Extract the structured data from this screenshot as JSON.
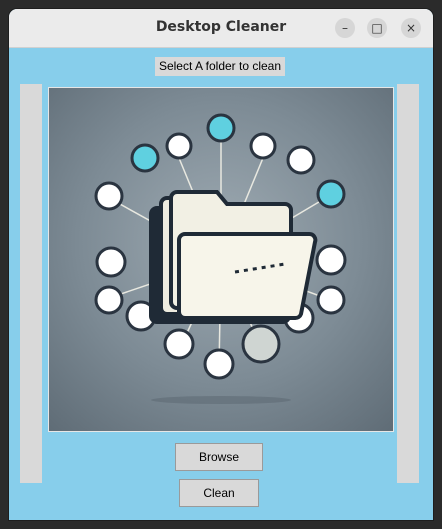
{
  "window": {
    "title": "Desktop Cleaner",
    "controls": {
      "minimize": "–",
      "maximize": "□",
      "close": "×"
    }
  },
  "instruction_label": "Select A folder to clean",
  "image": {
    "icon": "folder-network-illustration"
  },
  "buttons": {
    "browse": "Browse",
    "clean": "Clean"
  },
  "colors": {
    "background": "#87ceeb",
    "widget": "#d9d9d9",
    "accent": "#4ec9dc"
  }
}
